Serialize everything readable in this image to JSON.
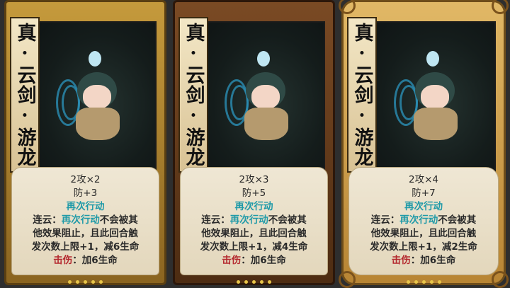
{
  "cards": [
    {
      "title": "真·云剑·游龙",
      "attack": "2攻×2",
      "defense": "防+3",
      "keyword": "再次行动",
      "effect_label": "连云：",
      "effect_keyword": "再次行动",
      "effect_text_1": "不会被其",
      "effect_text_2": "他效果阻止，且此回合触",
      "effect_text_3": "发次数上限+1，减6生命",
      "crit_label": "击伤",
      "crit_text": "：加6生命"
    },
    {
      "title": "真·云剑·游龙",
      "attack": "2攻×3",
      "defense": "防+5",
      "keyword": "再次行动",
      "effect_label": "连云：",
      "effect_keyword": "再次行动",
      "effect_text_1": "不会被其",
      "effect_text_2": "他效果阻止，且此回合触",
      "effect_text_3": "发次数上限+1，减4生命",
      "crit_label": "击伤",
      "crit_text": "：加6生命"
    },
    {
      "title": "真·云剑·游龙",
      "attack": "2攻×4",
      "defense": "防+7",
      "keyword": "再次行动",
      "effect_label": "连云：",
      "effect_keyword": "再次行动",
      "effect_text_1": "不会被其",
      "effect_text_2": "他效果阻止，且此回合触",
      "effect_text_3": "发次数上限+1，减2生命",
      "crit_label": "击伤",
      "crit_text": "：加6生命"
    }
  ],
  "colors": {
    "keyword": "#1f9aa8",
    "crit": "#b4282e"
  }
}
